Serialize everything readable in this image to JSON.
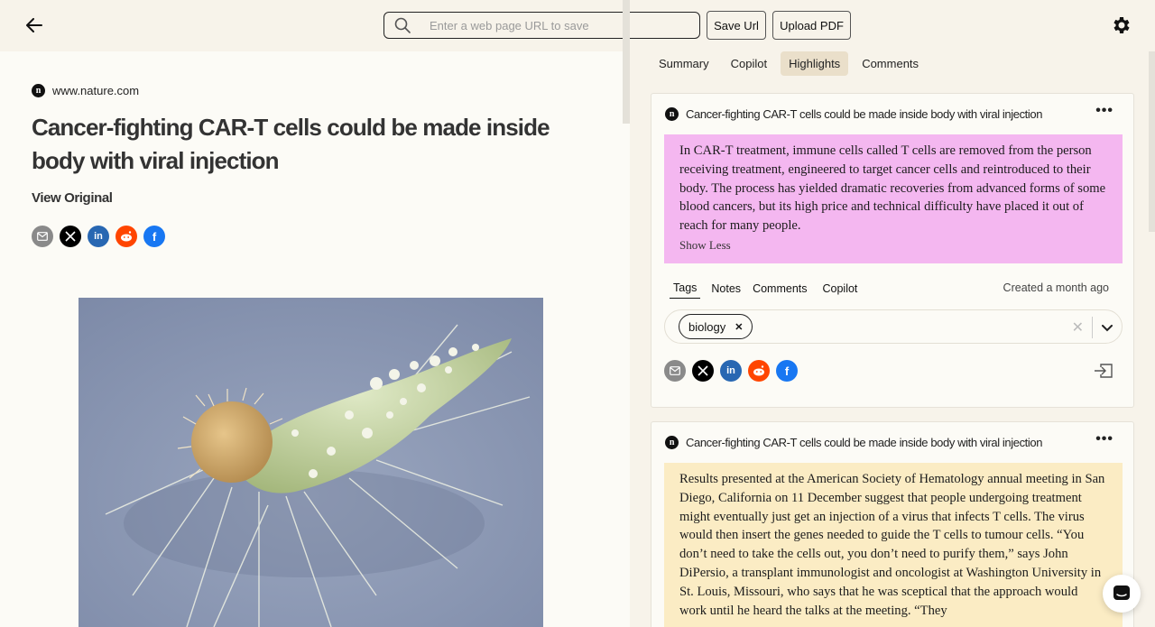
{
  "topbar": {
    "url_placeholder": "Enter a web page URL to save",
    "save_url_label": "Save Url",
    "upload_pdf_label": "Upload PDF"
  },
  "article": {
    "source": "www.nature.com",
    "source_logo": "n",
    "title": "Cancer-fighting CAR-T cells could be made inside body with viral injection",
    "view_original": "View Original"
  },
  "panel": {
    "tabs": [
      {
        "label": "Summary",
        "active": false
      },
      {
        "label": "Copilot",
        "active": false
      },
      {
        "label": "Highlights",
        "active": true
      },
      {
        "label": "Comments",
        "active": false
      }
    ]
  },
  "highlights": [
    {
      "article_title": "Cancer-fighting CAR-T cells could be made inside body with viral injection",
      "text": "In CAR-T treatment, immune cells called T cells are removed from the person receiving treatment, engineered to target cancer cells and reintroduced to their body. The process has yielded dramatic recoveries from advanced forms of some blood cancers, but its high price and technical difficulty have placed it out of reach for many people.",
      "show_less": "Show Less",
      "color": "#f4b7f0",
      "subtabs": [
        "Tags",
        "Notes",
        "Comments",
        "Copilot"
      ],
      "created": "Created a month ago",
      "tags": [
        "biology"
      ]
    },
    {
      "article_title": "Cancer-fighting CAR-T cells could be made inside body with viral injection",
      "text": "Results presented at the American Society of Hematology annual meeting in San Diego, California on 11 December suggest that people undergoing treatment might eventually just get an injection of a virus that infects T cells. The virus would then insert the genes needed to guide the T cells to tumour cells. “You don’t need to take the cells out, you don’t need to purify them,” says John DiPersio, a transplant immunologist and oncologist at Washington University in St. Louis, Missouri, who says that he was sceptical that the approach would work until he heard the talks at the meeting. “They",
      "color": "#fbecc4"
    }
  ]
}
